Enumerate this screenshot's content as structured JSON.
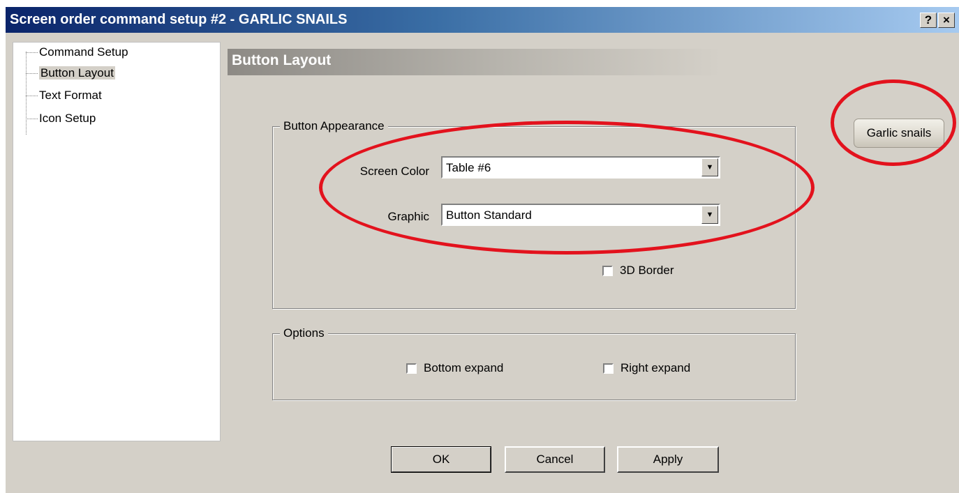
{
  "window": {
    "title": "Screen order command setup #2 - GARLIC SNAILS",
    "help_label": "?",
    "close_label": "×"
  },
  "tree": {
    "items": [
      {
        "label": "Command Setup",
        "selected": false
      },
      {
        "label": "Button Layout",
        "selected": true
      },
      {
        "label": "Text Format",
        "selected": false
      },
      {
        "label": "Icon Setup",
        "selected": false
      }
    ]
  },
  "section": {
    "title": "Button Layout"
  },
  "appearance": {
    "group_label": "Button Appearance",
    "screen_color_label": "Screen Color",
    "screen_color_value": "Table #6",
    "graphic_label": "Graphic",
    "graphic_value": "Button Standard",
    "border_3d_label": "3D Border",
    "border_3d_checked": false
  },
  "options": {
    "group_label": "Options",
    "bottom_expand_label": "Bottom expand",
    "bottom_expand_checked": false,
    "right_expand_label": "Right expand",
    "right_expand_checked": false
  },
  "preview": {
    "label": "Garlic snails"
  },
  "buttons": {
    "ok": "OK",
    "cancel": "Cancel",
    "apply": "Apply"
  },
  "icons": {
    "dropdown_arrow": "▼"
  },
  "colors": {
    "title_bar_start": "#0a246a",
    "title_bar_end": "#a6caf0",
    "dialog_bg": "#d4d0c8",
    "annotation_red": "#e3121d"
  }
}
